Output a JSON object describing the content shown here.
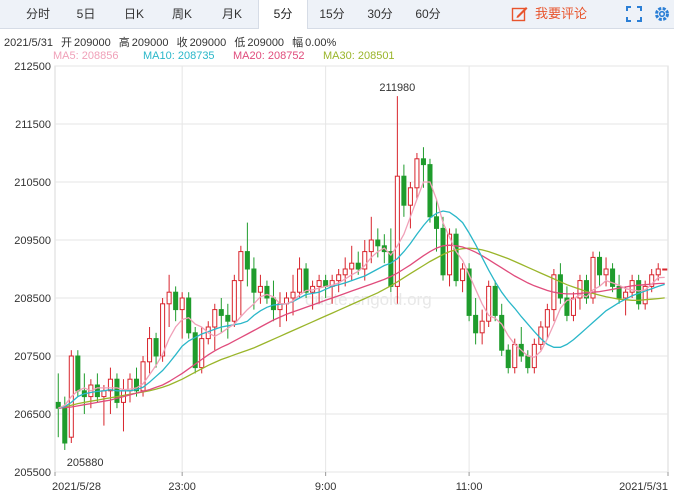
{
  "tabs": [
    {
      "label": "分时",
      "active": false
    },
    {
      "label": "5日",
      "active": false
    },
    {
      "label": "日K",
      "active": false
    },
    {
      "label": "周K",
      "active": false
    },
    {
      "label": "月K",
      "active": false
    },
    {
      "label": "5分",
      "active": true
    },
    {
      "label": "15分",
      "active": false
    },
    {
      "label": "30分",
      "active": false
    },
    {
      "label": "60分",
      "active": false
    }
  ],
  "toolbar": {
    "comment_label": "我要评论",
    "comment_icon": "edit-icon",
    "fullscreen_icon": "fullscreen-icon",
    "settings_icon": "gear-icon"
  },
  "info": {
    "date": "2021/5/31",
    "open_label": "开",
    "open": "209000",
    "high_label": "高",
    "high": "209000",
    "close_label": "收",
    "close": "209000",
    "low_label": "低",
    "low": "209000",
    "change_label": "幅",
    "change": "0.00%"
  },
  "ma_legend": [
    {
      "text": "MA5: 208856",
      "color": "#f0a0b8"
    },
    {
      "text": "MA10: 208735",
      "color": "#2ab7c9"
    },
    {
      "text": "MA20: 208752",
      "color": "#e04c7c"
    },
    {
      "text": "MA30: 208501",
      "color": "#9ab52a"
    }
  ],
  "watermark": "quote.cngold.org",
  "colors": {
    "up": "#d8242c",
    "down": "#1f9c2c",
    "grid": "#e6e6e6"
  },
  "chart_data": {
    "type": "candlestick",
    "yticks": [
      "212500",
      "211500",
      "210500",
      "209500",
      "208500",
      "207500",
      "206500",
      "205500"
    ],
    "ylim": [
      205500,
      212500
    ],
    "xlabels": [
      "2021/5/28",
      "23:00",
      "9:00",
      "11:00",
      "2021/5/31"
    ],
    "annotations": {
      "max": "211980",
      "min": "205880"
    },
    "candles": [
      [
        206700,
        207200,
        206100,
        206600
      ],
      [
        206600,
        206800,
        205880,
        206000
      ],
      [
        206100,
        207600,
        206000,
        207500
      ],
      [
        207500,
        207600,
        206800,
        206900
      ],
      [
        206900,
        207200,
        206500,
        206800
      ],
      [
        206800,
        207100,
        206600,
        207000
      ],
      [
        207000,
        207200,
        206700,
        206800
      ],
      [
        206800,
        207000,
        206300,
        206900
      ],
      [
        206900,
        207300,
        206500,
        207100
      ],
      [
        207100,
        207200,
        206600,
        206700
      ],
      [
        206700,
        207100,
        206200,
        206900
      ],
      [
        206900,
        207200,
        206700,
        207100
      ],
      [
        207100,
        207300,
        206800,
        206900
      ],
      [
        206900,
        207500,
        206800,
        207400
      ],
      [
        207400,
        208000,
        207200,
        207800
      ],
      [
        207800,
        207900,
        207300,
        207500
      ],
      [
        207500,
        208500,
        207400,
        208400
      ],
      [
        208400,
        208900,
        208000,
        208600
      ],
      [
        208600,
        208700,
        208100,
        208300
      ],
      [
        208300,
        208600,
        207800,
        208500
      ],
      [
        208500,
        208600,
        207800,
        207900
      ],
      [
        207900,
        208000,
        207200,
        207300
      ],
      [
        207300,
        208000,
        207200,
        207800
      ],
      [
        207800,
        208100,
        207700,
        208000
      ],
      [
        208000,
        208400,
        207600,
        208300
      ],
      [
        208300,
        208500,
        207900,
        208200
      ],
      [
        208200,
        208400,
        207800,
        208100
      ],
      [
        208100,
        208900,
        208000,
        208800
      ],
      [
        208800,
        209400,
        208200,
        209300
      ],
      [
        209300,
        209800,
        208700,
        209000
      ],
      [
        209000,
        209200,
        208300,
        208600
      ],
      [
        208600,
        208900,
        208400,
        208700
      ],
      [
        208700,
        208800,
        208400,
        208500
      ],
      [
        208500,
        208800,
        208100,
        208300
      ],
      [
        208300,
        208600,
        208000,
        208400
      ],
      [
        208400,
        208600,
        208100,
        208500
      ],
      [
        208500,
        208900,
        208200,
        208600
      ],
      [
        208600,
        209200,
        208500,
        209000
      ],
      [
        209000,
        209100,
        208500,
        208600
      ],
      [
        208600,
        208800,
        208300,
        208700
      ],
      [
        208700,
        208900,
        208400,
        208800
      ],
      [
        208800,
        208900,
        208500,
        208700
      ],
      [
        208700,
        208900,
        208400,
        208800
      ],
      [
        208800,
        209000,
        208600,
        208900
      ],
      [
        208900,
        209200,
        208700,
        209000
      ],
      [
        209000,
        209400,
        208800,
        209100
      ],
      [
        209100,
        209300,
        208900,
        209000
      ],
      [
        209000,
        209500,
        208800,
        209300
      ],
      [
        209300,
        209900,
        209100,
        209500
      ],
      [
        209500,
        209700,
        209200,
        209400
      ],
      [
        209400,
        209600,
        209100,
        209300
      ],
      [
        209300,
        209700,
        208600,
        208700
      ],
      [
        208700,
        211980,
        208400,
        210600
      ],
      [
        210600,
        210800,
        209900,
        210100
      ],
      [
        210100,
        210500,
        209700,
        210400
      ],
      [
        210400,
        211000,
        210200,
        210900
      ],
      [
        210900,
        211100,
        210400,
        210800
      ],
      [
        210800,
        210900,
        209800,
        209900
      ],
      [
        209900,
        210200,
        209300,
        209700
      ],
      [
        209700,
        209900,
        208800,
        208900
      ],
      [
        208900,
        209700,
        208700,
        209600
      ],
      [
        209600,
        209700,
        208700,
        208800
      ],
      [
        208800,
        209100,
        208600,
        209000
      ],
      [
        209000,
        209100,
        208100,
        208200
      ],
      [
        208200,
        208500,
        207700,
        207900
      ],
      [
        207900,
        208300,
        207700,
        208100
      ],
      [
        208100,
        208800,
        208000,
        208700
      ],
      [
        208700,
        208800,
        208100,
        208200
      ],
      [
        208200,
        208400,
        207500,
        207600
      ],
      [
        207600,
        207700,
        207200,
        207300
      ],
      [
        207300,
        207800,
        207200,
        207700
      ],
      [
        207700,
        208000,
        207400,
        207500
      ],
      [
        207500,
        207600,
        207200,
        207300
      ],
      [
        207300,
        207800,
        207200,
        207700
      ],
      [
        207700,
        208100,
        207600,
        208000
      ],
      [
        208000,
        208400,
        207800,
        208300
      ],
      [
        208300,
        209000,
        208100,
        208900
      ],
      [
        208900,
        209100,
        208400,
        208500
      ],
      [
        208500,
        208700,
        208100,
        208200
      ],
      [
        208200,
        208600,
        208100,
        208500
      ],
      [
        208500,
        208900,
        208300,
        208800
      ],
      [
        208800,
        208900,
        208400,
        208500
      ],
      [
        208500,
        209300,
        208400,
        209200
      ],
      [
        209200,
        209300,
        208700,
        208900
      ],
      [
        208900,
        209200,
        208700,
        209000
      ],
      [
        209000,
        209100,
        208600,
        208700
      ],
      [
        208700,
        208900,
        208400,
        208500
      ],
      [
        208500,
        208700,
        208200,
        208600
      ],
      [
        208600,
        208900,
        208500,
        208800
      ],
      [
        208800,
        208900,
        208300,
        208400
      ],
      [
        208400,
        208800,
        208300,
        208700
      ],
      [
        208700,
        209000,
        208600,
        208900
      ],
      [
        208900,
        209100,
        208800,
        209000
      ],
      [
        209000,
        209000,
        209000,
        209000
      ]
    ],
    "ma5": [
      206600,
      206650,
      206800,
      206900,
      206950,
      206900,
      206950,
      206950,
      206950,
      206950,
      206920,
      206930,
      206950,
      207020,
      207180,
      207340,
      207530,
      207800,
      208000,
      208130,
      208160,
      208050,
      208000,
      207900,
      207840,
      207900,
      207980,
      208050,
      208180,
      208300,
      208400,
      208520,
      208560,
      208520,
      208400,
      208400,
      208450,
      208550,
      208630,
      208640,
      208670,
      208700,
      208720,
      208760,
      208830,
      208900,
      208960,
      209060,
      209200,
      209300,
      209360,
      209240,
      209400,
      209600,
      209900,
      210200,
      210500,
      210500,
      210200,
      209800,
      209550,
      209300,
      209150,
      208900,
      208650,
      208400,
      208200,
      208150,
      208050,
      207850,
      207700,
      207600,
      207500,
      207480,
      207580,
      207800,
      208050,
      208320,
      208460,
      208480,
      208560,
      208520,
      208640,
      208700,
      208800,
      208760,
      208720,
      208660,
      208640,
      208620,
      208640,
      208740,
      208850,
      208856
    ],
    "ma10": [
      206600,
      206630,
      206700,
      206800,
      206850,
      206870,
      206890,
      206900,
      206920,
      206900,
      206900,
      206900,
      206920,
      206960,
      207050,
      207150,
      207250,
      207380,
      207520,
      207670,
      207760,
      207820,
      207880,
      207920,
      207960,
      208000,
      208020,
      208040,
      208060,
      208100,
      208200,
      208280,
      208340,
      208380,
      208390,
      208400,
      208440,
      208500,
      208560,
      208580,
      208600,
      208650,
      208700,
      208730,
      208760,
      208800,
      208840,
      208880,
      208940,
      209000,
      209060,
      209100,
      209180,
      209300,
      209440,
      209600,
      209750,
      209880,
      209960,
      210000,
      209980,
      209900,
      209800,
      209620,
      209420,
      209200,
      208980,
      208780,
      208600,
      208450,
      208320,
      208180,
      208050,
      207920,
      207800,
      207700,
      207650,
      207650,
      207700,
      207780,
      207880,
      207980,
      208080,
      208180,
      208280,
      208350,
      208420,
      208480,
      208540,
      208580,
      208620,
      208660,
      208700,
      208735
    ],
    "ma20": [
      206600,
      206610,
      206620,
      206640,
      206660,
      206680,
      206700,
      206720,
      206740,
      206770,
      206800,
      206830,
      206860,
      206890,
      206920,
      206960,
      207000,
      207060,
      207130,
      207200,
      207280,
      207360,
      207440,
      207520,
      207590,
      207650,
      207700,
      207760,
      207820,
      207880,
      207940,
      208000,
      208060,
      208120,
      208170,
      208220,
      208260,
      208300,
      208340,
      208380,
      208420,
      208460,
      208500,
      208540,
      208580,
      208620,
      208660,
      208700,
      208740,
      208780,
      208820,
      208870,
      208930,
      209000,
      209070,
      209150,
      209230,
      209300,
      209360,
      209400,
      209410,
      209400,
      209380,
      209340,
      209290,
      209230,
      209160,
      209090,
      209020,
      208950,
      208880,
      208820,
      208760,
      208710,
      208670,
      208630,
      208600,
      208580,
      208570,
      208570,
      208580,
      208590,
      208600,
      208610,
      208630,
      208650,
      208670,
      208690,
      208710,
      208720,
      208730,
      208740,
      208750,
      208752
    ],
    "ma30": [
      206600,
      206620,
      206650,
      206680,
      206700,
      206720,
      206740,
      206760,
      206780,
      206800,
      206820,
      206840,
      206860,
      206880,
      206900,
      206930,
      206960,
      207000,
      207050,
      207100,
      207160,
      207220,
      207280,
      207340,
      207390,
      207440,
      207480,
      207520,
      207560,
      207600,
      207640,
      207690,
      207740,
      207790,
      207840,
      207890,
      207940,
      207990,
      208040,
      208090,
      208140,
      208190,
      208240,
      208290,
      208340,
      208390,
      208440,
      208490,
      208540,
      208590,
      208650,
      208710,
      208780,
      208850,
      208920,
      208990,
      209060,
      209130,
      209190,
      209250,
      209300,
      209330,
      209350,
      209360,
      209350,
      209330,
      209300,
      209260,
      209220,
      209180,
      209130,
      209080,
      209030,
      208980,
      208930,
      208880,
      208830,
      208780,
      208730,
      208690,
      208650,
      208610,
      208580,
      208550,
      208520,
      208500,
      208480,
      208470,
      208460,
      208460,
      208470,
      208480,
      208490,
      208501
    ]
  }
}
